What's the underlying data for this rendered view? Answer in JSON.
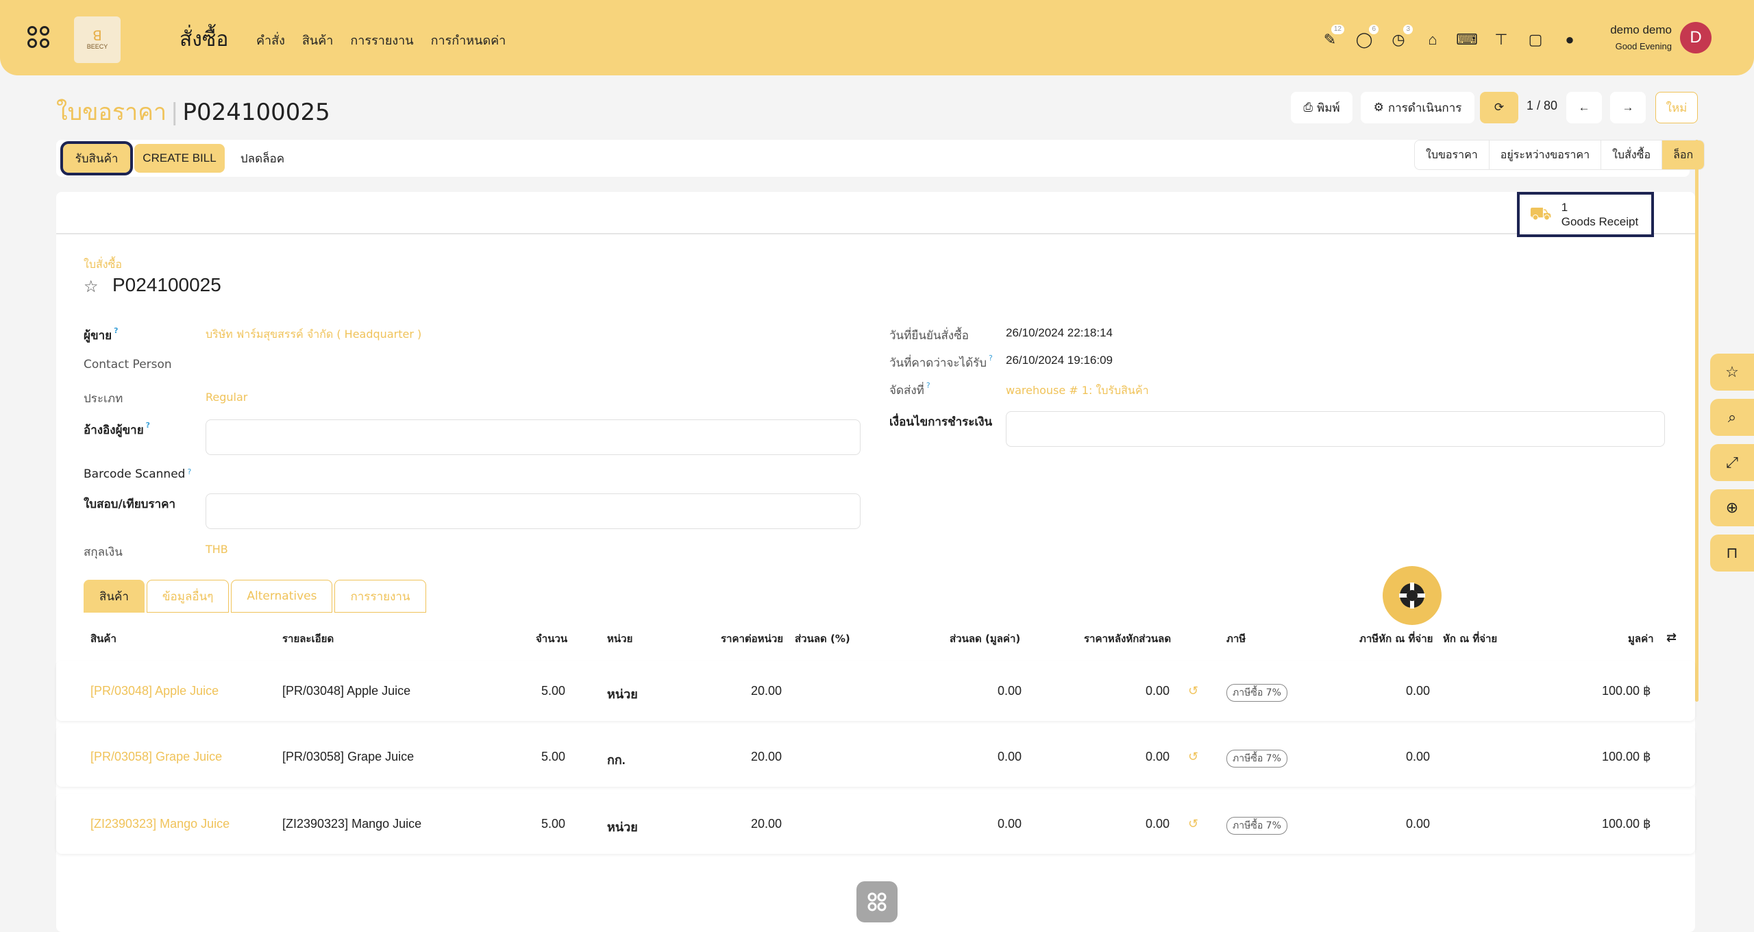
{
  "navbar": {
    "app_title": "สั่งซื้อ",
    "logo_text": "BEECY",
    "menu": [
      "คำสั่ง",
      "สินค้า",
      "การรายงาน",
      "การกำหนดค่า"
    ],
    "icons": [
      {
        "name": "activity-icon",
        "badge": "12"
      },
      {
        "name": "chat-icon",
        "badge": "6"
      },
      {
        "name": "timer-icon",
        "badge": "3"
      },
      {
        "name": "bank-icon",
        "badge": ""
      },
      {
        "name": "code-icon",
        "badge": ""
      },
      {
        "name": "paint-roller-icon",
        "badge": ""
      },
      {
        "name": "note-icon",
        "badge": ""
      },
      {
        "name": "lightbulb-icon",
        "badge": ""
      }
    ],
    "user_name": "demo demo",
    "greeting": "Good Evening",
    "avatar_letter": "D"
  },
  "control": {
    "breadcrumb_parent": "ใบขอราคา",
    "breadcrumb_current": "P024100025",
    "print_label": "พิมพ์",
    "action_label": "การดำเนินการ",
    "pager": "1 / 80",
    "new_label": "ใหม่"
  },
  "actions": {
    "receive_label": "รับสินค้า",
    "create_bill_label": "CREATE BILL",
    "unlock_label": "ปลดล็อค"
  },
  "statusbar": {
    "stages": [
      "ใบขอราคา",
      "อยู่ระหว่างขอราคา",
      "ใบสั่งซื้อ",
      "ล็อก"
    ],
    "active": "ล็อก"
  },
  "smart_button": {
    "count": "1",
    "label": "Goods Receipt"
  },
  "form": {
    "doc_type": "ใบสั่งซื้อ",
    "doc_number": "P024100025",
    "vendor_label": "ผู้ขาย",
    "vendor_value": "บริษัท ฟาร์มสุขสรรค์ จำกัด ( Headquarter )",
    "contact_label": "Contact Person",
    "type_label": "ประเภท",
    "type_value": "Regular",
    "vendor_ref_label": "อ้างอิงผู้ขาย",
    "barcode_label": "Barcode Scanned",
    "compare_label": "ใบสอบ/เทียบราคา",
    "currency_label": "สกุลเงิน",
    "currency_value": "THB",
    "confirm_date_label": "วันที่ยืนยันสั่งซื้อ",
    "confirm_date_value": "26/10/2024 22:18:14",
    "expected_label": "วันที่คาดว่าจะได้รับ",
    "expected_value": "26/10/2024 19:16:09",
    "deliver_label": "จัดส่งที่",
    "deliver_value": "warehouse # 1: ใบรับสินค้า",
    "payment_terms_label": "เงื่อนไขการชำระเงิน"
  },
  "tabs": [
    "สินค้า",
    "ข้อมูลอื่นๆ",
    "Alternatives",
    "การรายงาน"
  ],
  "table": {
    "headers": [
      "สินค้า",
      "รายละเอียด",
      "จำนวน",
      "หน่วย",
      "ราคาต่อหน่วย",
      "ส่วนลด (%)",
      "ส่วนลด (มูลค่า)",
      "ราคาหลังหักส่วนลด",
      "ภาษี",
      "ภาษีหัก ณ ที่จ่าย",
      "หัก ณ ที่จ่าย",
      "มูลค่า"
    ],
    "rows": [
      {
        "product": "[PR/03048] Apple Juice",
        "desc": "[PR/03048] Apple Juice",
        "qty": "5.00",
        "uom": "หน่วย",
        "price": "20.00",
        "disc_amt": "0.00",
        "after_disc": "0.00",
        "tax": "ภาษีซื้อ 7%",
        "wht": "0.00",
        "subtotal": "100.00 ฿"
      },
      {
        "product": "[PR/03058] Grape Juice",
        "desc": "[PR/03058] Grape Juice",
        "qty": "5.00",
        "uom": "กก.",
        "price": "20.00",
        "disc_amt": "0.00",
        "after_disc": "0.00",
        "tax": "ภาษีซื้อ 7%",
        "wht": "0.00",
        "subtotal": "100.00 ฿"
      },
      {
        "product": "[ZI2390323] Mango Juice",
        "desc": "[ZI2390323] Mango Juice",
        "qty": "5.00",
        "uom": "หน่วย",
        "price": "20.00",
        "disc_amt": "0.00",
        "after_disc": "0.00",
        "tax": "ภาษีซื้อ 7%",
        "wht": "0.00",
        "subtotal": "100.00 ฿"
      }
    ]
  },
  "colors": {
    "accent": "#f7d47c",
    "link": "#f0c35a",
    "highlight": "#1d2452",
    "avatar": "#c5384f"
  }
}
